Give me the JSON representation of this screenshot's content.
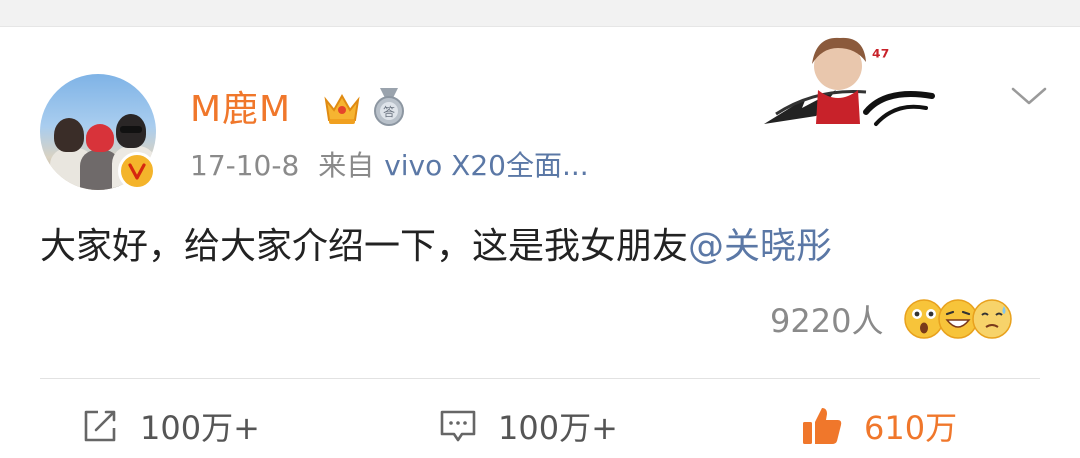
{
  "post": {
    "username": "M鹿M",
    "date": "17-10-8",
    "source_prefix": "来自",
    "source": "vivo X20全面...",
    "text_main": "大家好，给大家介绍一下，这是我女朋友",
    "mention": "@关晓彤",
    "reaction_count": "9220人",
    "reaction_emojis": [
      "shocked-emoji-icon",
      "grinning-emoji-icon",
      "sweat-emoji-icon"
    ]
  },
  "actions": {
    "repost_label": "100万+",
    "comment_label": "100万+",
    "like_label": "610万"
  },
  "icons": {
    "verified": "v-badge-icon",
    "crown": "crown-icon",
    "medal": "medal-icon",
    "more": "chevron-down-icon"
  },
  "colors": {
    "username": "#f0772b",
    "link": "#5b78a6",
    "like": "#f0772b",
    "muted": "#8a8a8a"
  }
}
